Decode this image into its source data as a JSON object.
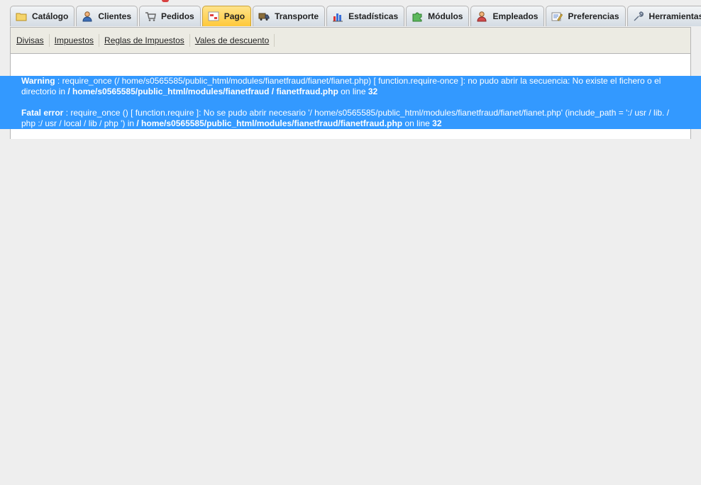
{
  "tabs": [
    {
      "label": "Catálogo",
      "icon": "folder-icon"
    },
    {
      "label": "Clientes",
      "icon": "user-icon"
    },
    {
      "label": "Pedidos",
      "icon": "cart-icon"
    },
    {
      "label": "Pago",
      "icon": "payment-icon",
      "active": true
    },
    {
      "label": "Transporte",
      "icon": "truck-icon"
    },
    {
      "label": "Estadísticas",
      "icon": "bar-chart-icon"
    },
    {
      "label": "Módulos",
      "icon": "puzzle-icon"
    },
    {
      "label": "Empleados",
      "icon": "employee-icon"
    },
    {
      "label": "Preferencias",
      "icon": "preferences-icon"
    },
    {
      "label": "Herramientas",
      "icon": "wrench-icon"
    }
  ],
  "subtabs": [
    "Divisas",
    "Impuestos",
    "Reglas de Impuestos",
    "Vales de descuento"
  ],
  "errors": {
    "warning": {
      "label": "Warning",
      "text1": " : require_once (/ home/s0565585/public_html/modules/fianetfraud/fianet/fianet.php) [ function.require-once ]: no pudo abrir la secuencia: No existe el fichero o el directorio in ",
      "path": "/ home/s0565585/public_html/modules/fianetfraud / fianetfraud.php",
      "text2": " on line ",
      "line": "32"
    },
    "fatal": {
      "label": "Fatal error",
      "text1": " : require_once () [ function.require ]: No se pudo abrir necesario '/ home/s0565585/public_html/modules/fianetfraud/fianet/fianet.php' (include_path = ':/ usr / lib. / php :/ usr / local / lib / php ') in ",
      "path": "/ home/s0565585/public_html/modules/fianetfraud/fianetfraud.php",
      "text2": " on line ",
      "line": "32"
    }
  },
  "colors": {
    "selection": "#3399ff",
    "active_tab": "#ffc93a",
    "background": "#eeeeee"
  }
}
